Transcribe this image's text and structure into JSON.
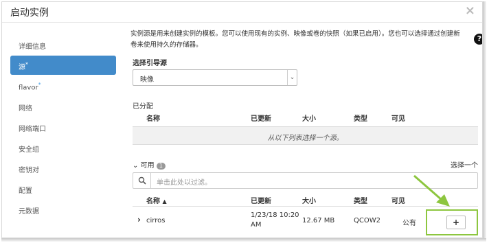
{
  "dialog": {
    "title": "启动实例"
  },
  "sidebar": {
    "items": [
      {
        "label": "详细信息",
        "required": false,
        "active": false
      },
      {
        "label": "源",
        "required": true,
        "active": true
      },
      {
        "label": "flavor",
        "required": true,
        "active": false
      },
      {
        "label": "网络",
        "required": false,
        "active": false
      },
      {
        "label": "网络端口",
        "required": false,
        "active": false
      },
      {
        "label": "安全组",
        "required": false,
        "active": false
      },
      {
        "label": "密钥对",
        "required": false,
        "active": false
      },
      {
        "label": "配置",
        "required": false,
        "active": false
      },
      {
        "label": "元数据",
        "required": false,
        "active": false
      }
    ],
    "required_marker": "*"
  },
  "main": {
    "help_line1": "实例源是用来创建实例的模板。您可以使用现有的实例、映像或卷的快照（如果已启用）。您也可以选择通过创建新",
    "help_line2": "卷来使用持久的存储器。",
    "boot_source_label": "选择引导源",
    "boot_source_value": "映像",
    "allocated_label": "已分配",
    "columns": {
      "name": "名称",
      "updated": "已更新",
      "size": "大小",
      "type": "类型",
      "visibility": "可见"
    },
    "allocated_empty": "从以下列表选择一个源。",
    "available_label": "可用",
    "available_count": "1",
    "select_one": "选择一个",
    "search_placeholder": "单击此处以过滤。",
    "available_rows": [
      {
        "name": "cirros",
        "updated_line1": "1/23/18 10:20",
        "updated_line2": "AM",
        "size": "12.67 MB",
        "type": "QCOW2",
        "visibility": "公有",
        "add_label": "+"
      }
    ]
  },
  "icons": {
    "close": "close-icon",
    "help": "question-circle-icon",
    "search": "search-icon",
    "expand": "chevron-right-icon",
    "collapse": "chevron-down-icon",
    "sort": "caret-up-icon",
    "dropdown": "chevron-down-icon"
  },
  "colors": {
    "active": "#428bca",
    "highlight": "#8dc63f",
    "required_star": "#4aa3e8"
  }
}
